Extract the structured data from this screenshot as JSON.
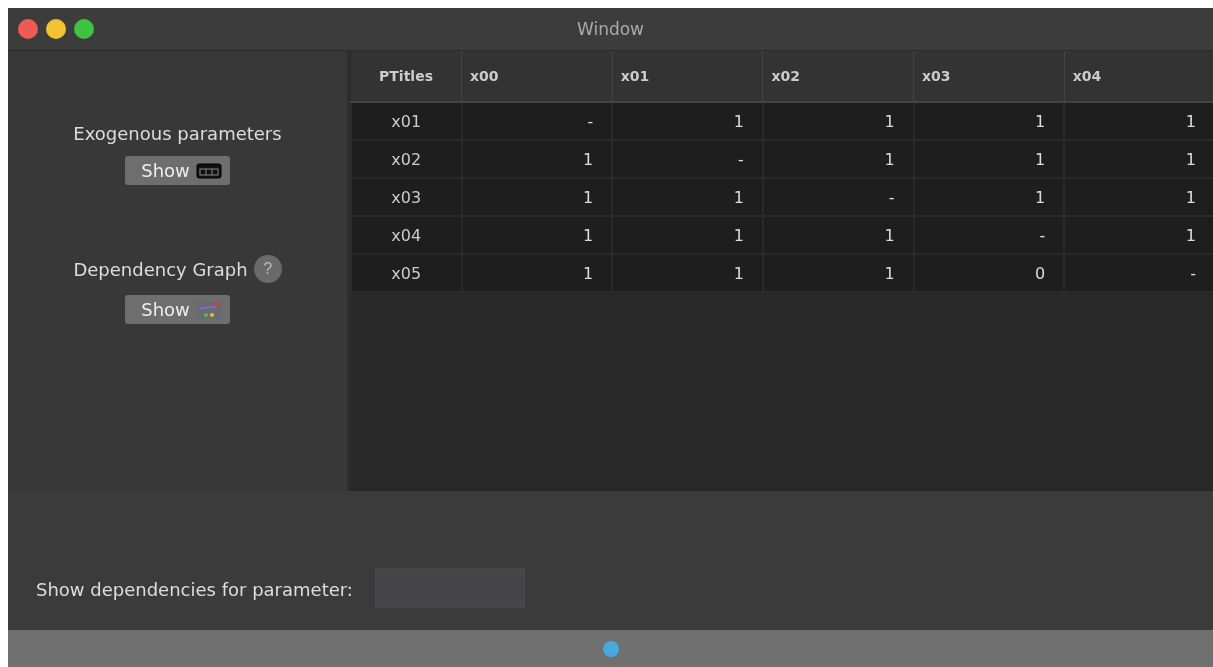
{
  "window": {
    "title": "Window"
  },
  "exogenous": {
    "label": "Exogenous parameters",
    "button": "Show"
  },
  "dependency_graph": {
    "label": "Dependency Graph",
    "help": "?",
    "button": "Show"
  },
  "table": {
    "columns": [
      "PTitles",
      "x00",
      "x01",
      "x02",
      "x03",
      "x04"
    ],
    "rows": [
      [
        "x01",
        "-",
        "1",
        "1",
        "1",
        "1"
      ],
      [
        "x02",
        "1",
        "-",
        "1",
        "1",
        "1"
      ],
      [
        "x03",
        "1",
        "1",
        "-",
        "1",
        "1"
      ],
      [
        "x04",
        "1",
        "1",
        "1",
        "-",
        "1"
      ],
      [
        "x05",
        "1",
        "1",
        "1",
        "0",
        "-"
      ]
    ]
  },
  "footer": {
    "label": "Show dependencies for parameter:"
  }
}
